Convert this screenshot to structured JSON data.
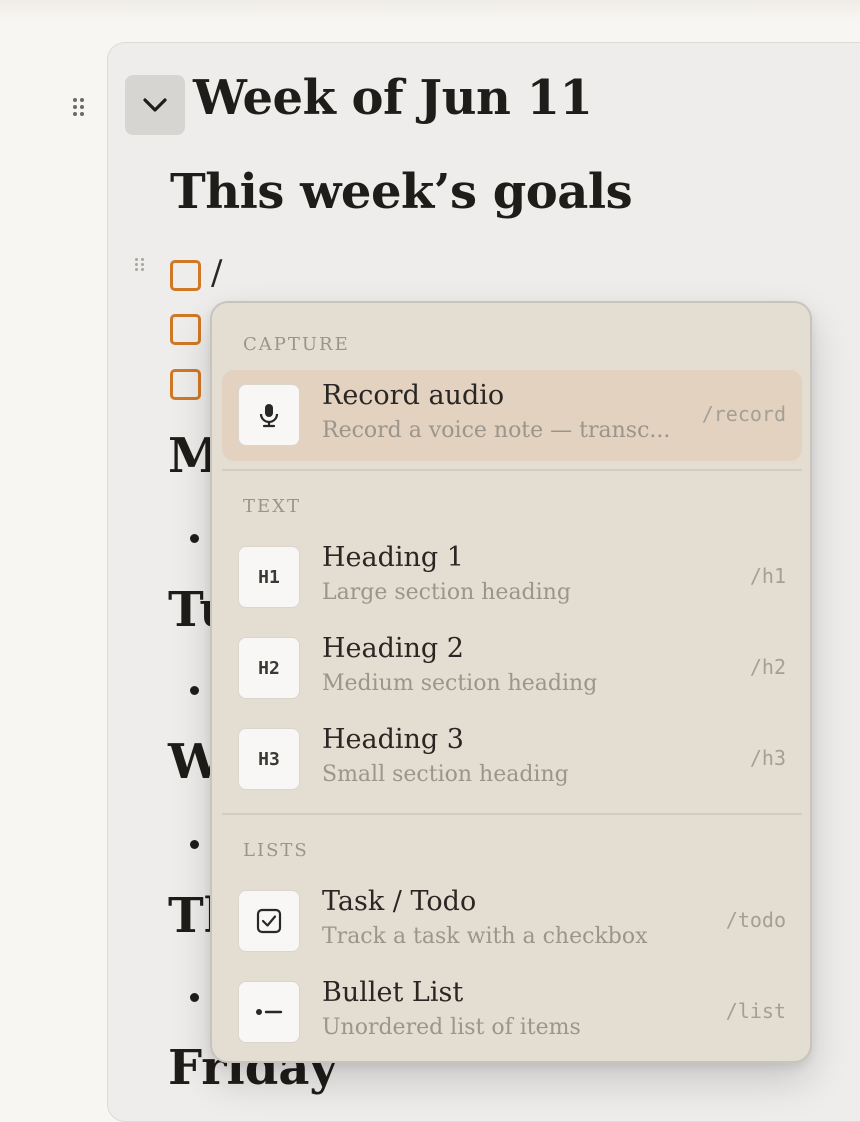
{
  "page": {
    "week_title": "Week of Jun 11",
    "goals_title": "This week’s goals",
    "slash_text": "/",
    "days": [
      {
        "label": "M"
      },
      {
        "label": "Tu"
      },
      {
        "label": "W"
      },
      {
        "label": "Th"
      },
      {
        "label": "Friday"
      }
    ]
  },
  "menu": {
    "sections": [
      {
        "label": "CAPTURE",
        "items": [
          {
            "icon": "microphone-icon",
            "name": "Record audio",
            "description": "Record a voice note — transc...",
            "command": "/record",
            "selected": true
          }
        ]
      },
      {
        "label": "TEXT",
        "items": [
          {
            "icon": "heading-1-icon",
            "icon_text": "H1",
            "name": "Heading 1",
            "description": "Large section heading",
            "command": "/h1"
          },
          {
            "icon": "heading-2-icon",
            "icon_text": "H2",
            "name": "Heading 2",
            "description": "Medium section heading",
            "command": "/h2"
          },
          {
            "icon": "heading-3-icon",
            "icon_text": "H3",
            "name": "Heading 3",
            "description": "Small section heading",
            "command": "/h3"
          }
        ]
      },
      {
        "label": "LISTS",
        "items": [
          {
            "icon": "checkbox-icon",
            "name": "Task / Todo",
            "description": "Track a task with a checkbox",
            "command": "/todo"
          },
          {
            "icon": "bullet-list-icon",
            "name": "Bullet List",
            "description": "Unordered list of items",
            "command": "/list"
          }
        ]
      }
    ]
  },
  "colors": {
    "checkbox_accent": "#d07826",
    "menu_bg": "#e4ddd1",
    "selected_item_bg": "#e2d2bf"
  }
}
